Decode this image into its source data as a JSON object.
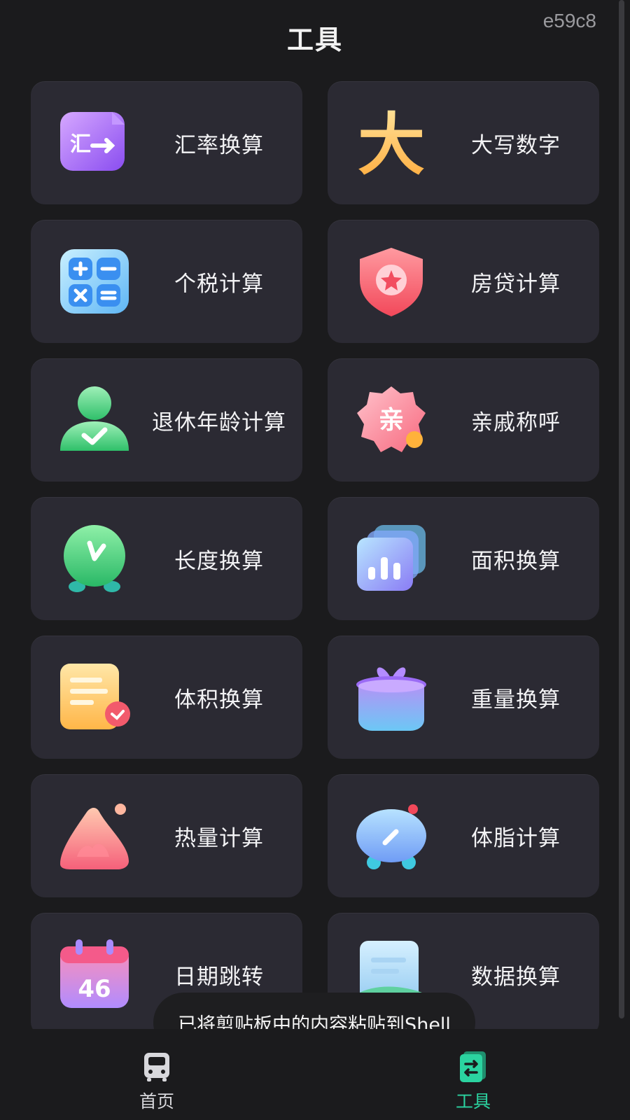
{
  "header": {
    "title": "工具",
    "device_code": "e59c8"
  },
  "tools": [
    {
      "label": "汇率换算",
      "icon": "currency-exchange-icon"
    },
    {
      "label": "大写数字",
      "icon": "big-character-icon"
    },
    {
      "label": "个税计算",
      "icon": "calculator-icon"
    },
    {
      "label": "房贷计算",
      "icon": "shield-star-icon"
    },
    {
      "label": "退休年龄计算",
      "icon": "person-check-icon"
    },
    {
      "label": "亲戚称呼",
      "icon": "relative-badge-icon"
    },
    {
      "label": "长度换算",
      "icon": "clock-icon"
    },
    {
      "label": "面积换算",
      "icon": "chart-cards-icon"
    },
    {
      "label": "体积换算",
      "icon": "document-badge-icon"
    },
    {
      "label": "重量换算",
      "icon": "gift-box-icon"
    },
    {
      "label": "热量计算",
      "icon": "flame-mountain-icon"
    },
    {
      "label": "体脂计算",
      "icon": "scale-icon"
    },
    {
      "label": "日期跳转",
      "icon": "calendar-icon"
    },
    {
      "label": "数据换算",
      "icon": "receipt-scroll-icon"
    }
  ],
  "calendar_number": "46",
  "relative_char": "亲",
  "big_char": "大",
  "toast": "已将剪贴板中的内容粘贴到Shell",
  "nav": {
    "home_label": "首页",
    "tools_label": "工具"
  },
  "colors": {
    "background": "#1b1b1d",
    "card": "#2b2a33",
    "accent": "#2bd3a0"
  }
}
